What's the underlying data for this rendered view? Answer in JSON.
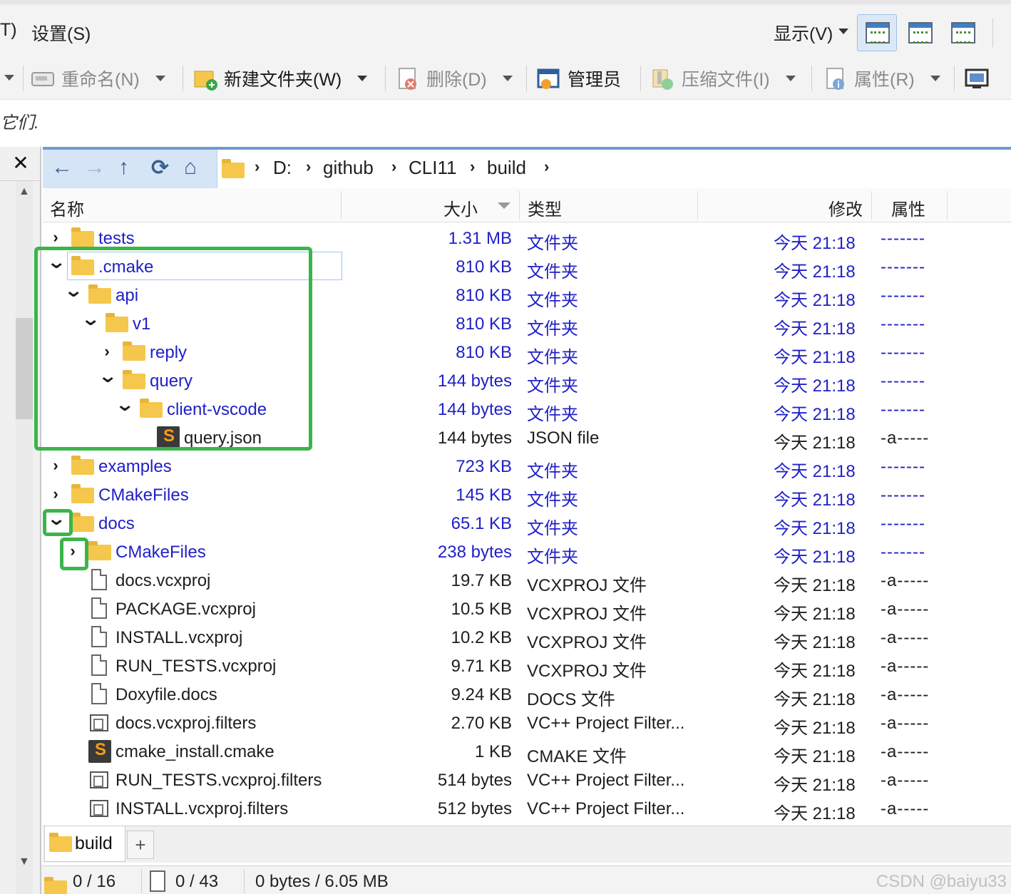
{
  "menu": {
    "partial_left": "T)",
    "settings": "设置(S)",
    "view": "显示(V)"
  },
  "toolbar": {
    "rename": "重命名(N)",
    "new_folder": "新建文件夹(W)",
    "delete": "删除(D)",
    "admin": "管理员",
    "compress": "压缩文件(I)",
    "properties": "属性(R)"
  },
  "hint_text": "它们.",
  "left_pane": {
    "close": "✕"
  },
  "breadcrumb": [
    "D:",
    "github",
    "CLI11",
    "build"
  ],
  "columns": {
    "name": "名称",
    "size": "大小",
    "type": "类型",
    "modified": "修改",
    "attrs": "属性"
  },
  "rows": [
    {
      "name": "tests",
      "size": "1.31 MB",
      "type": "文件夹",
      "date": "今天  21:18",
      "attrs": "-------",
      "kind": "folder",
      "expander": "›"
    },
    {
      "name": ".cmake",
      "size": "810 KB",
      "type": "文件夹",
      "date": "今天  21:18",
      "attrs": "-------",
      "kind": "folder",
      "expander": "⌄"
    },
    {
      "name": "api",
      "size": "810 KB",
      "type": "文件夹",
      "date": "今天  21:18",
      "attrs": "-------",
      "kind": "folder",
      "expander": "⌄"
    },
    {
      "name": "v1",
      "size": "810 KB",
      "type": "文件夹",
      "date": "今天  21:18",
      "attrs": "-------",
      "kind": "folder",
      "expander": "⌄"
    },
    {
      "name": "reply",
      "size": "810 KB",
      "type": "文件夹",
      "date": "今天  21:18",
      "attrs": "-------",
      "kind": "folder",
      "expander": "›"
    },
    {
      "name": "query",
      "size": "144 bytes",
      "type": "文件夹",
      "date": "今天  21:18",
      "attrs": "-------",
      "kind": "folder",
      "expander": "⌄"
    },
    {
      "name": "client-vscode",
      "size": "144 bytes",
      "type": "文件夹",
      "date": "今天  21:18",
      "attrs": "-------",
      "kind": "folder",
      "expander": "⌄"
    },
    {
      "name": "query.json",
      "size": "144 bytes",
      "type": "JSON file",
      "date": "今天  21:18",
      "attrs": "-a-----",
      "kind": "sublime",
      "expander": ""
    },
    {
      "name": "examples",
      "size": "723 KB",
      "type": "文件夹",
      "date": "今天  21:18",
      "attrs": "-------",
      "kind": "folder",
      "expander": "›"
    },
    {
      "name": "CMakeFiles",
      "size": "145 KB",
      "type": "文件夹",
      "date": "今天  21:18",
      "attrs": "-------",
      "kind": "folder",
      "expander": "›"
    },
    {
      "name": "docs",
      "size": "65.1 KB",
      "type": "文件夹",
      "date": "今天  21:18",
      "attrs": "-------",
      "kind": "folder",
      "expander": "⌄"
    },
    {
      "name": "CMakeFiles",
      "size": "238 bytes",
      "type": "文件夹",
      "date": "今天  21:18",
      "attrs": "-------",
      "kind": "folder",
      "expander": "›"
    },
    {
      "name": "docs.vcxproj",
      "size": "19.7 KB",
      "type": "VCXPROJ 文件",
      "date": "今天  21:18",
      "attrs": "-a-----",
      "kind": "doc",
      "expander": ""
    },
    {
      "name": "PACKAGE.vcxproj",
      "size": "10.5 KB",
      "type": "VCXPROJ 文件",
      "date": "今天  21:18",
      "attrs": "-a-----",
      "kind": "doc",
      "expander": ""
    },
    {
      "name": "INSTALL.vcxproj",
      "size": "10.2 KB",
      "type": "VCXPROJ 文件",
      "date": "今天  21:18",
      "attrs": "-a-----",
      "kind": "doc",
      "expander": ""
    },
    {
      "name": "RUN_TESTS.vcxproj",
      "size": "9.71 KB",
      "type": "VCXPROJ 文件",
      "date": "今天  21:18",
      "attrs": "-a-----",
      "kind": "doc",
      "expander": ""
    },
    {
      "name": "Doxyfile.docs",
      "size": "9.24 KB",
      "type": "DOCS 文件",
      "date": "今天  21:18",
      "attrs": "-a-----",
      "kind": "doc",
      "expander": ""
    },
    {
      "name": "docs.vcxproj.filters",
      "size": "2.70 KB",
      "type": "VC++ Project Filter...",
      "date": "今天  21:18",
      "attrs": "-a-----",
      "kind": "filter",
      "expander": ""
    },
    {
      "name": "cmake_install.cmake",
      "size": "1 KB",
      "type": "CMAKE 文件",
      "date": "今天  21:18",
      "attrs": "-a-----",
      "kind": "sublime",
      "expander": ""
    },
    {
      "name": "RUN_TESTS.vcxproj.filters",
      "size": "514 bytes",
      "type": "VC++ Project Filter...",
      "date": "今天  21:18",
      "attrs": "-a-----",
      "kind": "filter",
      "expander": ""
    },
    {
      "name": "INSTALL.vcxproj.filters",
      "size": "512 bytes",
      "type": "VC++ Project Filter...",
      "date": "今天  21:18",
      "attrs": "-a-----",
      "kind": "filter",
      "expander": ""
    }
  ],
  "tabs": [
    {
      "label": "build"
    }
  ],
  "tab_add": "+",
  "status": {
    "folders": "0 / 16",
    "files": "0 / 43",
    "size": "0 bytes / 6.05 MB"
  },
  "watermark": "CSDN @baiyu33",
  "colors": {
    "folder_text": "#2020c8",
    "highlight": "#3bb54a",
    "address_bg": "#d6e5f5"
  }
}
